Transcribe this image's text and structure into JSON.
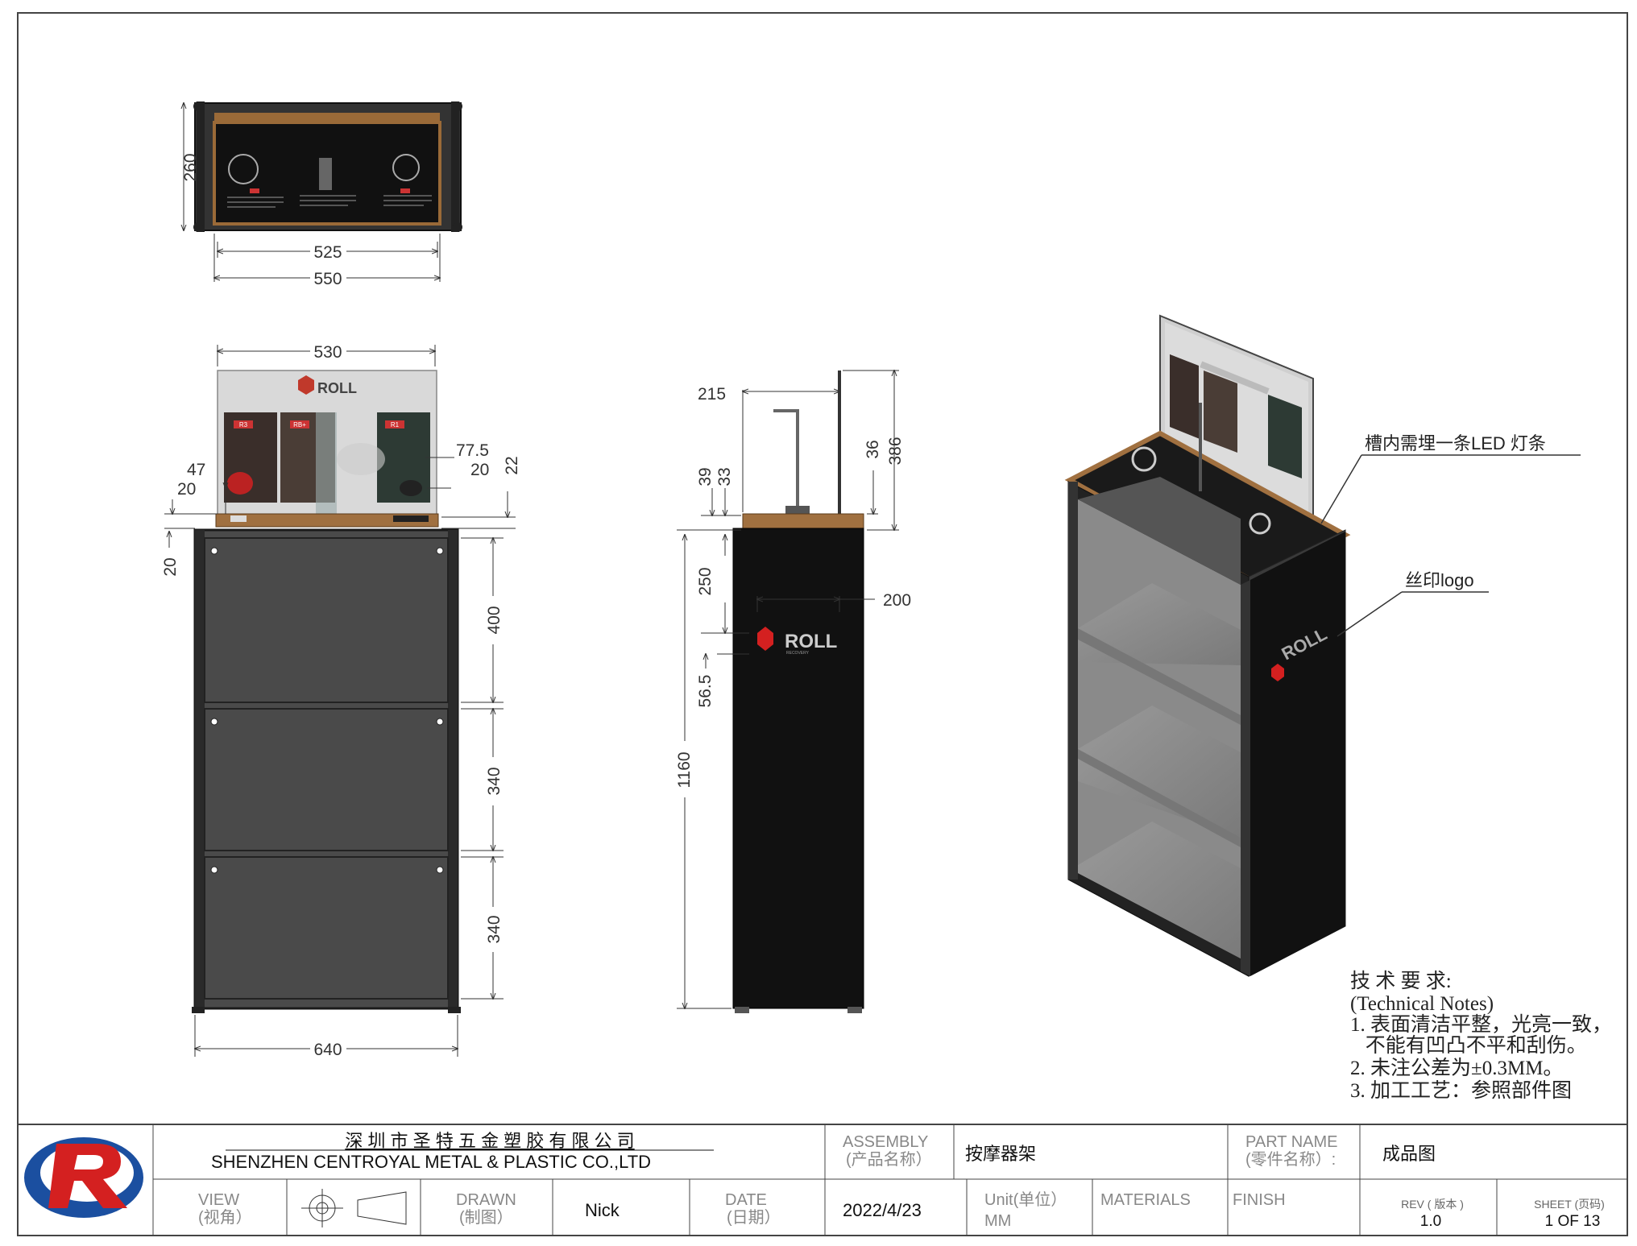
{
  "drawing": {
    "top_view": {
      "depth": "260",
      "inner_width": "525",
      "outer_width": "550"
    },
    "front_view": {
      "sign_width": "530",
      "dim_47": "47",
      "dim_20a": "20",
      "dim_775": "77.5",
      "dim_20b": "20",
      "dim_22": "22",
      "dim_20c": "20",
      "shelf_400": "400",
      "shelf_340a": "340",
      "shelf_340b": "340",
      "base_width": "640",
      "sign_brand": "ROLL",
      "sign_products": [
        "R3",
        "RB+",
        "R1"
      ]
    },
    "side_view": {
      "d215": "215",
      "d39": "39",
      "d33": "33",
      "d36": "36",
      "d386": "386",
      "d250": "250",
      "d200": "200",
      "d565": "56.5",
      "d1160": "1160",
      "brand": "ROLL",
      "brand_sub": "RECOVERY"
    },
    "iso_view": {
      "callout_led": "槽内需埋一条LED 灯条",
      "callout_logo": "丝印logo",
      "brand": "ROLL"
    }
  },
  "notes": {
    "title": "技 术 要 求:",
    "subtitle": "(Technical Notes)",
    "items": [
      "1. 表面清洁平整，光亮一致，",
      "   不能有凹凸不平和刮伤。",
      "2. 未注公差为±0.3MM。",
      "3. 加工工艺：参照部件图"
    ]
  },
  "title_block": {
    "company_cn": "深 圳 市 圣 特 五 金 塑 胶 有 限 公 司",
    "company_en": "SHENZHEN CENTROYAL METAL & PLASTIC CO.,LTD",
    "assembly_label": "ASSEMBLY",
    "assembly_label_cn": "(产品名称）",
    "assembly_value": "按摩器架",
    "part_name_label": "PART NAME",
    "part_name_label_cn": "(零件名称）:",
    "part_name_value": "成品图",
    "view_label": "VIEW",
    "view_label_cn": "(视角）",
    "drawn_label": "DRAWN",
    "drawn_label_cn": "(制图）",
    "drawn_value": "Nick",
    "date_label": "DATE",
    "date_label_cn": "(日期）",
    "date_value": "2022/4/23",
    "unit_label": "Unit(单位）",
    "unit_value": "MM",
    "materials_label": "MATERIALS",
    "finish_label": "FINISH",
    "rev_label": "REV ( 版本 )",
    "rev_value": "1.0",
    "sheet_label": "SHEET (页码)",
    "sheet_value": "1 OF 13"
  },
  "colors": {
    "cabinet": "#4a4a4a",
    "frame": "#1a1a1a",
    "wood": "#a07040",
    "logo_red": "#d42020",
    "logo_blue": "#1b4fa0"
  }
}
